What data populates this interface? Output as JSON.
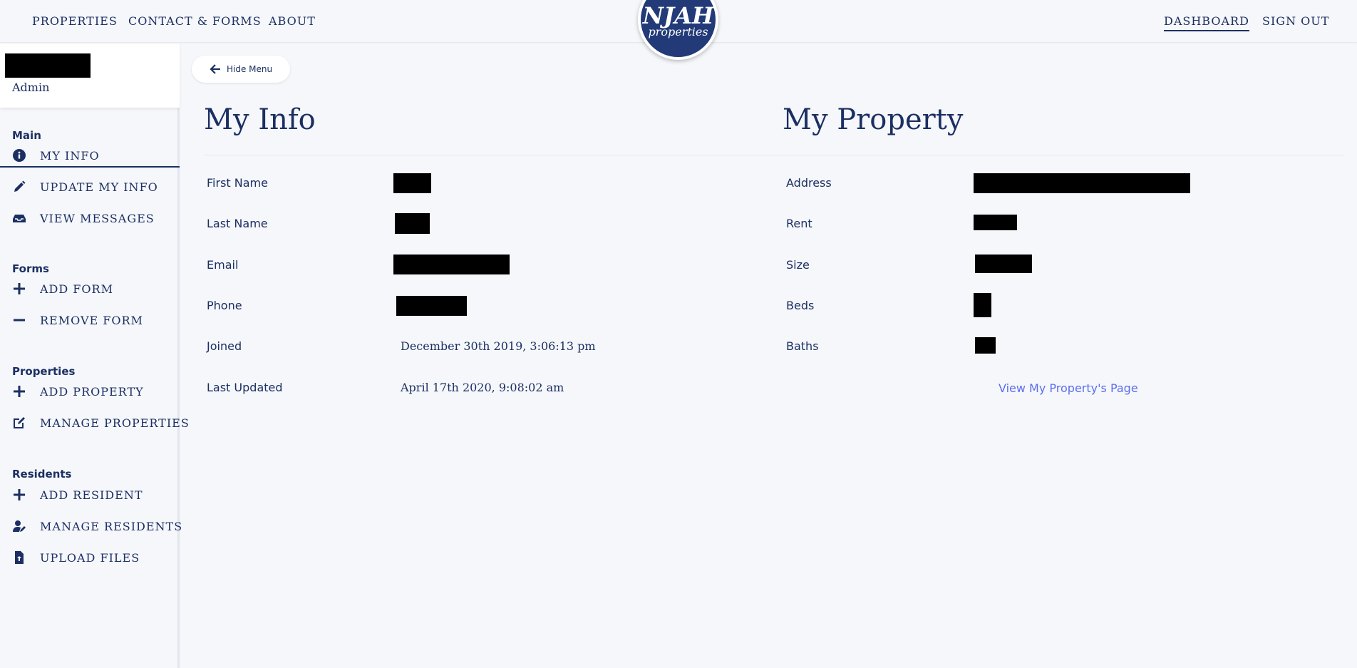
{
  "nav": {
    "left": [
      "PROPERTIES",
      "CONTACT & FORMS",
      "ABOUT"
    ],
    "right": [
      "DASHBOARD",
      "SIGN OUT"
    ],
    "active": "DASHBOARD"
  },
  "logo": {
    "main": "NJAH",
    "sub": "properties"
  },
  "sidebar": {
    "user_role": "Admin",
    "sections": [
      {
        "title": "Main",
        "items": [
          {
            "label": "MY INFO",
            "icon": "info-circle-icon",
            "active": true
          },
          {
            "label": "UPDATE MY INFO",
            "icon": "pencil-icon"
          },
          {
            "label": "VIEW MESSAGES",
            "icon": "inbox-icon"
          }
        ]
      },
      {
        "title": "Forms",
        "items": [
          {
            "label": "ADD FORM",
            "icon": "plus-icon"
          },
          {
            "label": "REMOVE FORM",
            "icon": "minus-icon"
          }
        ]
      },
      {
        "title": "Properties",
        "items": [
          {
            "label": "ADD PROPERTY",
            "icon": "plus-icon"
          },
          {
            "label": "MANAGE PROPERTIES",
            "icon": "edit-square-icon"
          }
        ]
      },
      {
        "title": "Residents",
        "items": [
          {
            "label": "ADD RESIDENT",
            "icon": "plus-icon"
          },
          {
            "label": "MANAGE RESIDENTS",
            "icon": "user-edit-icon"
          },
          {
            "label": "UPLOAD FILES",
            "icon": "file-upload-icon"
          }
        ]
      }
    ]
  },
  "hide_menu_label": "Hide Menu",
  "my_info": {
    "title": "My Info",
    "rows": [
      {
        "label": "First Name",
        "value": null
      },
      {
        "label": "Last Name",
        "value": null
      },
      {
        "label": "Email",
        "value": null
      },
      {
        "label": "Phone",
        "value": null
      },
      {
        "label": "Joined",
        "value": "December 30th 2019, 3:06:13 pm"
      },
      {
        "label": "Last Updated",
        "value": "April 17th 2020, 9:08:02 am"
      }
    ]
  },
  "my_property": {
    "title": "My Property",
    "rows": [
      {
        "label": "Address",
        "value": null
      },
      {
        "label": "Rent",
        "value": null
      },
      {
        "label": "Size",
        "value": null
      },
      {
        "label": "Beds",
        "value": null
      },
      {
        "label": "Baths",
        "value": null
      }
    ],
    "link_label": "View My Property's Page"
  },
  "colors": {
    "navy": "#1b2f63",
    "link": "#5a6ff0",
    "background": "#f6f7fa"
  }
}
